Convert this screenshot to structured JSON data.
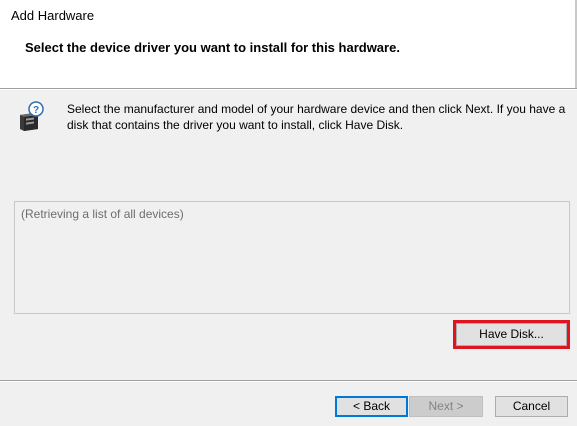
{
  "window": {
    "title": "Add Hardware"
  },
  "header": {
    "subtitle": "Select the device driver you want to install for this hardware."
  },
  "main": {
    "icon": "hardware-device-with-question-icon",
    "instructions": "Select the manufacturer and model of your hardware device and then click Next. If you have a disk that contains the driver you want to install, click Have Disk.",
    "device_list": {
      "placeholder": "(Retrieving a list of all devices)"
    },
    "have_disk_label": "Have Disk..."
  },
  "footer": {
    "back_label": "< Back",
    "next_label": "Next >",
    "cancel_label": "Cancel"
  },
  "colors": {
    "highlight": "#e0141e",
    "focus": "#0078d7",
    "background": "#f0f0f0"
  }
}
